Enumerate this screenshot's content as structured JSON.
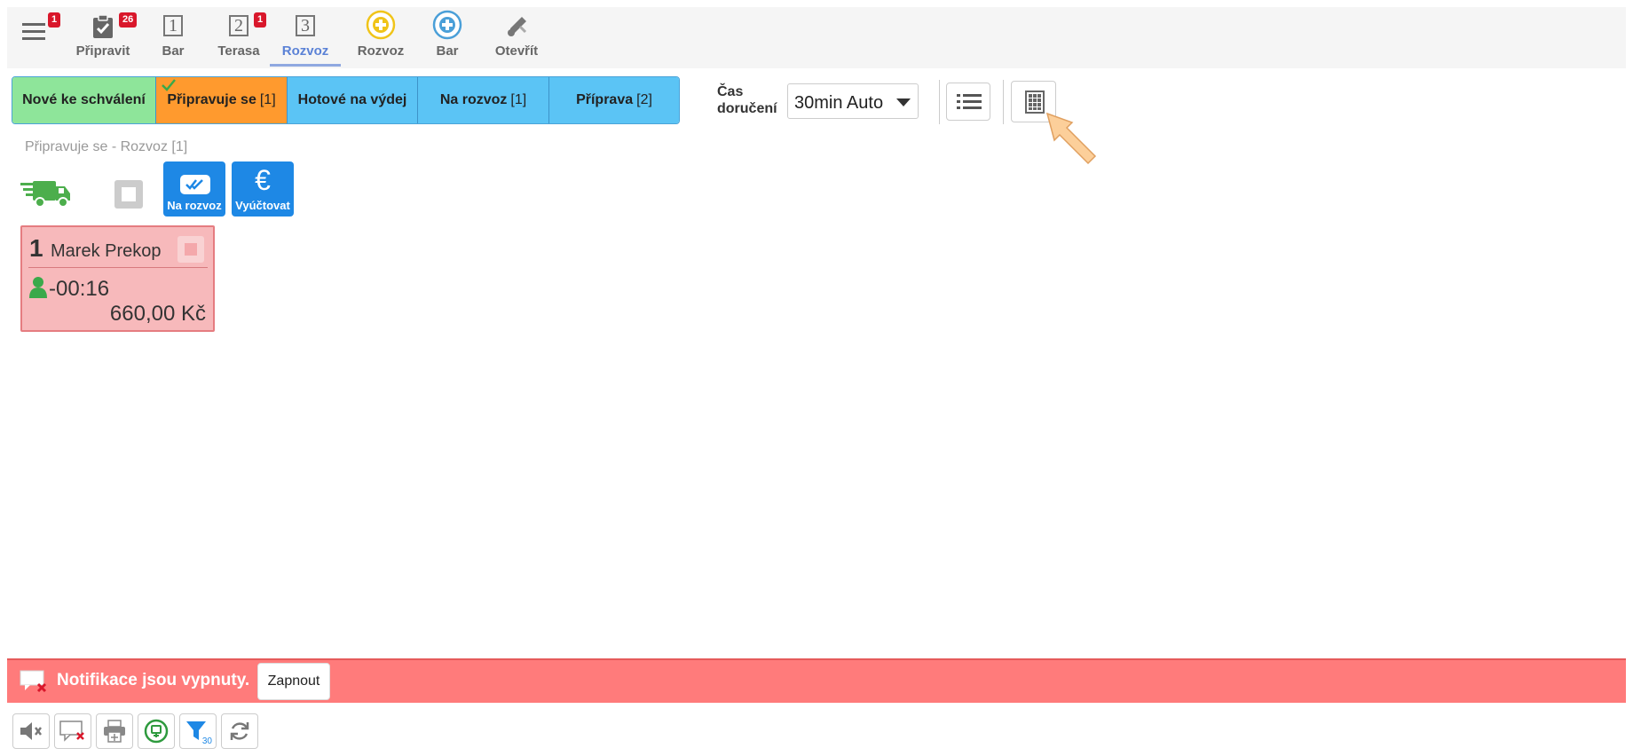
{
  "toolbar": {
    "items": [
      {
        "label": "",
        "icon": "menu-icon",
        "badge": "1"
      },
      {
        "label": "Připravit",
        "icon": "clipboard-check-icon",
        "badge": "26"
      },
      {
        "label": "Bar",
        "icon": "number-1-icon",
        "glyph": "1"
      },
      {
        "label": "Terasa",
        "icon": "number-2-icon",
        "glyph": "2",
        "badge": "1"
      },
      {
        "label": "Rozvoz",
        "icon": "number-3-icon",
        "glyph": "3",
        "active": true
      },
      {
        "label": "Rozvoz",
        "icon": "plus-circle-yellow-icon"
      },
      {
        "label": "Bar",
        "icon": "plus-circle-blue-icon"
      },
      {
        "label": "Otevřít",
        "icon": "wrench-icon"
      }
    ]
  },
  "status_tabs": [
    {
      "label": "Nové ke schválení",
      "count": "",
      "color": "#8ee59a"
    },
    {
      "label": "Připravuje se",
      "count": "[1]",
      "color": "#ff9a2e",
      "selected": true
    },
    {
      "label": "Hotové na výdej",
      "count": "",
      "color": "#5bc4f5"
    },
    {
      "label": "Na rozvoz",
      "count": "[1]",
      "color": "#5bc4f5"
    },
    {
      "label": "Příprava",
      "count": "[2]",
      "color": "#5bc4f5"
    }
  ],
  "delivery": {
    "label_line1": "Čas",
    "label_line2": "doručení",
    "selected": "30min Auto"
  },
  "view_buttons": {
    "list": "list-icon",
    "grid": "grid-icon"
  },
  "section": {
    "title": "Připravuje se - Rozvoz [1]",
    "actions": [
      {
        "label": "Na rozvoz",
        "icon": "double-check-icon"
      },
      {
        "label": "Vyúčtovat",
        "icon": "euro-icon"
      }
    ]
  },
  "order": {
    "number": "1",
    "customer": "Marek Prekop",
    "time": "-00:16",
    "amount": "660,00 Kč"
  },
  "notification": {
    "text": "Notifikace jsou vypnuty.",
    "button": "Zapnout"
  },
  "bottom_tools": [
    {
      "icon": "mute-icon"
    },
    {
      "icon": "notification-off-icon"
    },
    {
      "icon": "printer-icon"
    },
    {
      "icon": "money-circle-icon"
    },
    {
      "icon": "filter-icon",
      "badge": "30"
    },
    {
      "icon": "refresh-icon"
    }
  ],
  "colors": {
    "accent": "#5b82d6",
    "danger": "#d9172b",
    "notify": "#ff7b7b",
    "action": "#1e88e5"
  }
}
